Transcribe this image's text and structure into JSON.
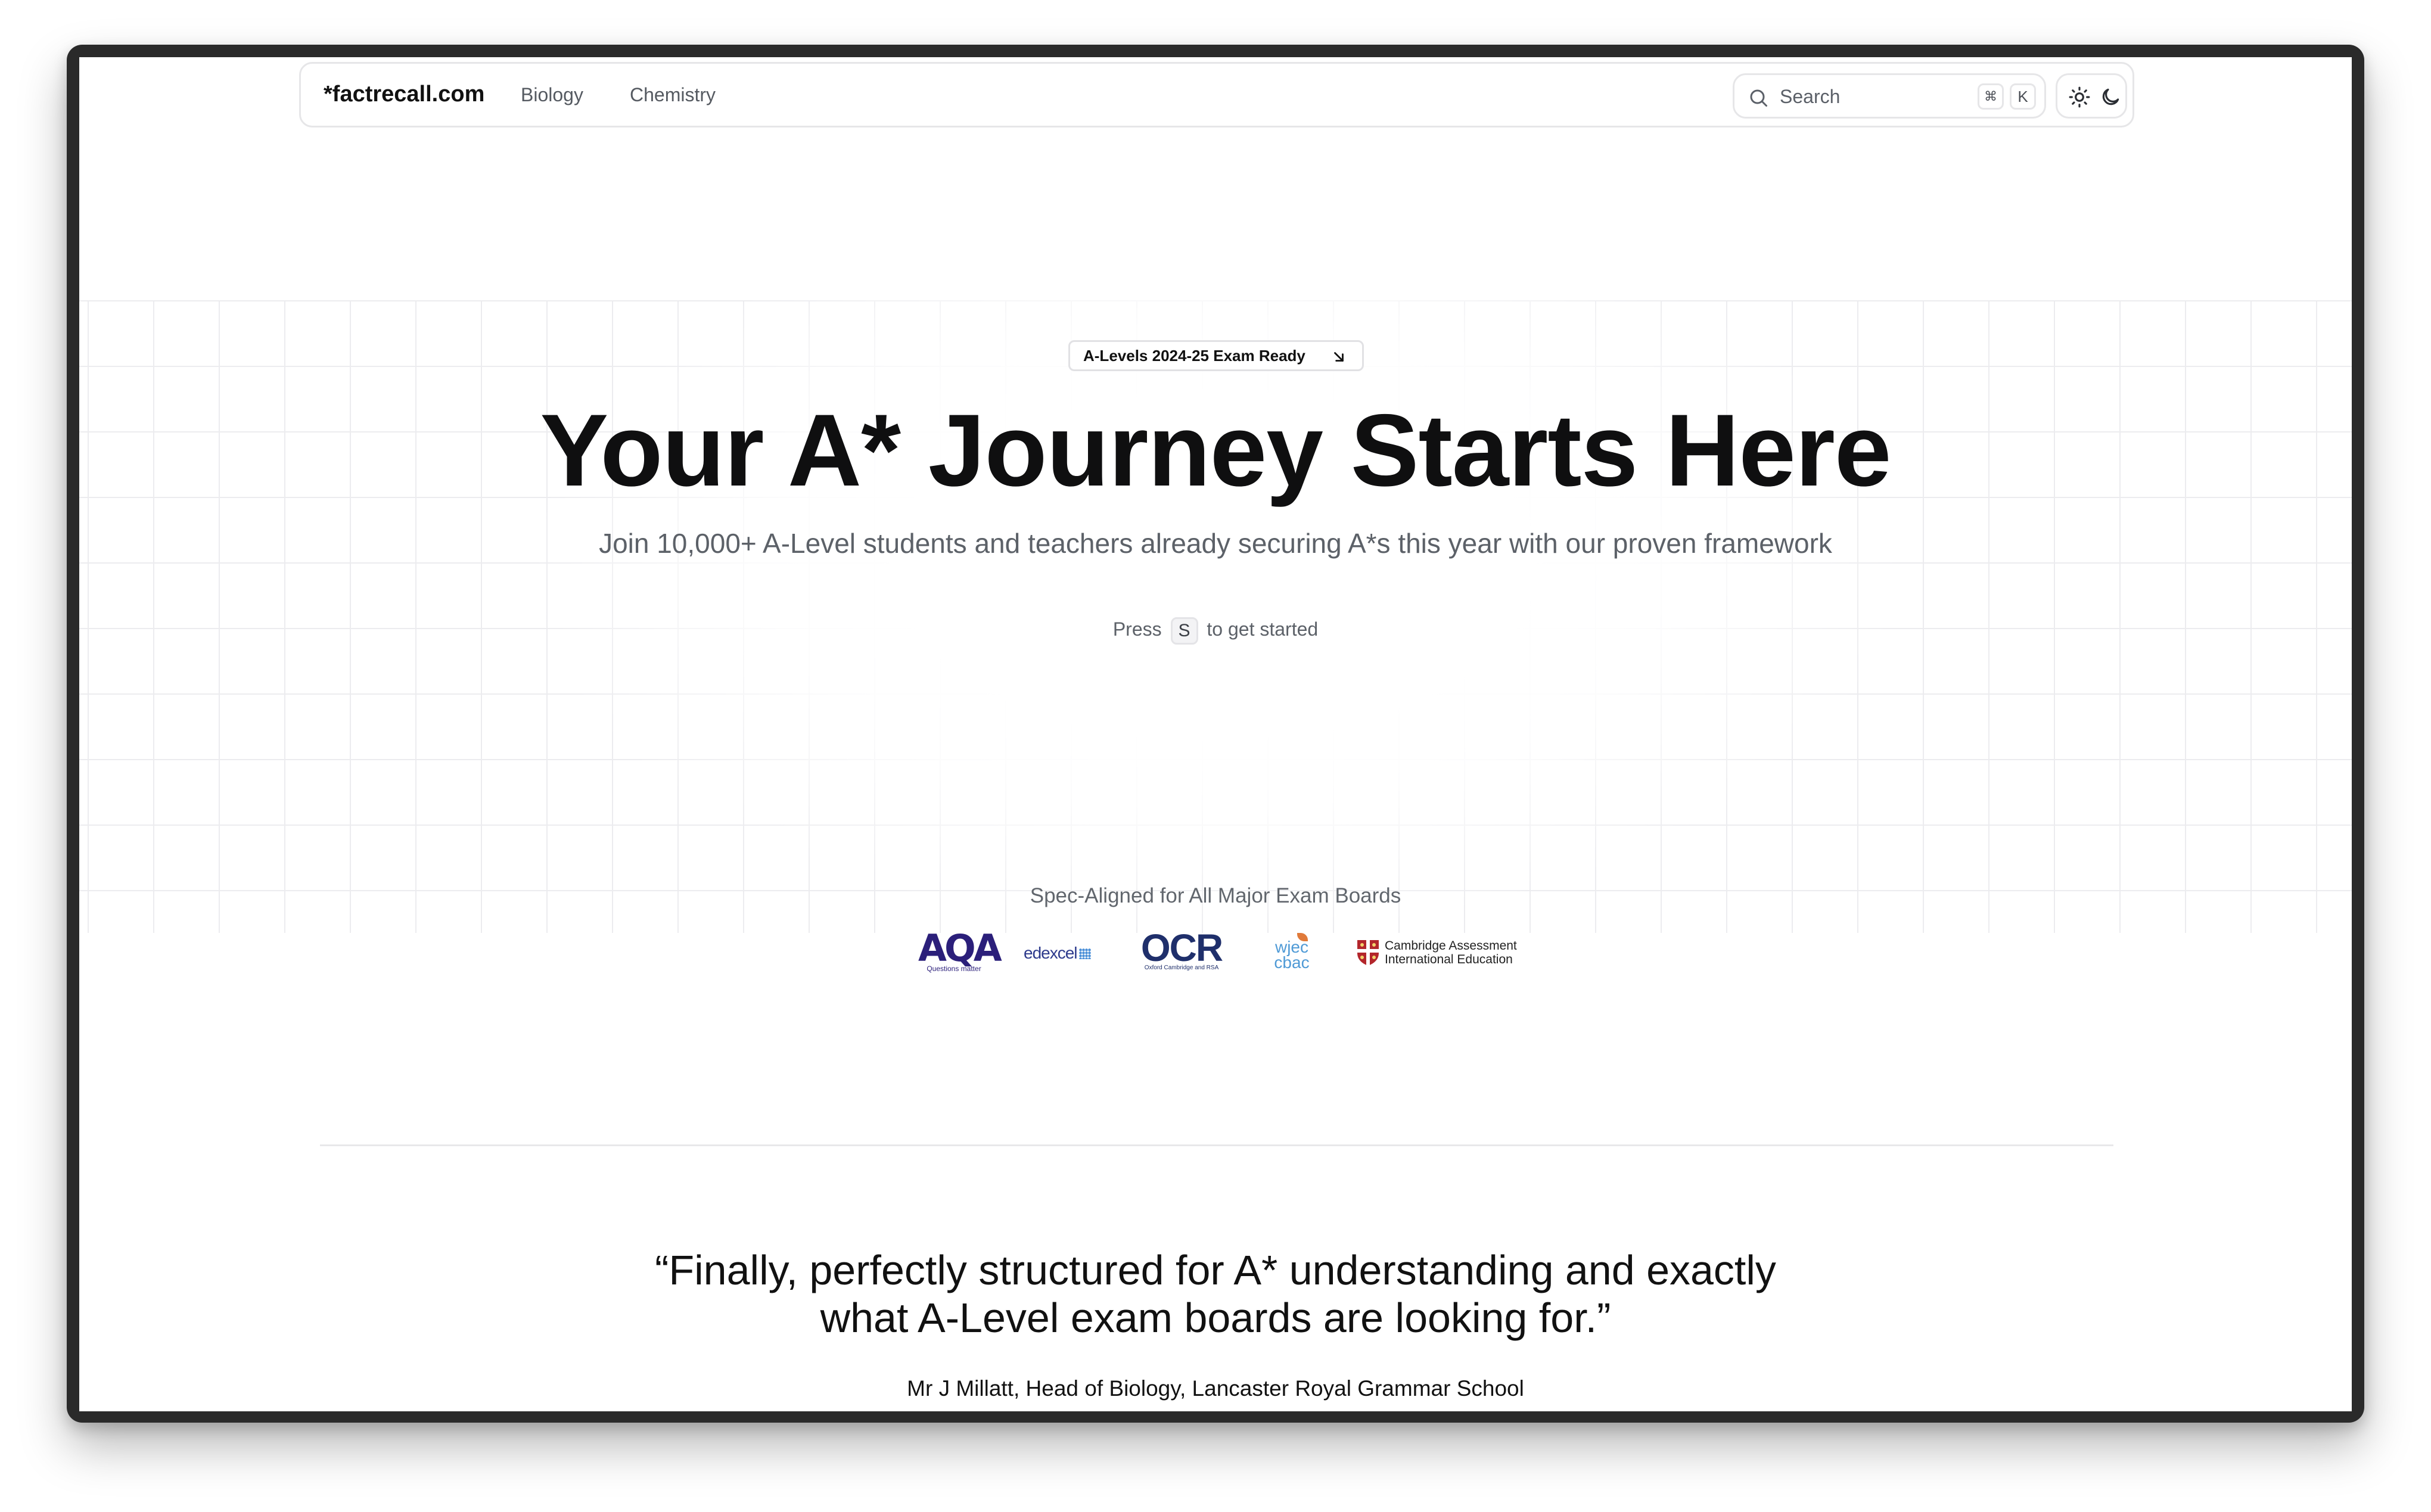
{
  "nav": {
    "brand": "*factrecall.com",
    "links": [
      "Biology",
      "Chemistry"
    ],
    "search": {
      "label": "Search",
      "shortcut_mod": "⌘",
      "shortcut_key": "K"
    },
    "theme_icons": [
      "sun-icon",
      "moon-icon"
    ]
  },
  "hero": {
    "badge": "A-Levels 2024-25 Exam Ready",
    "title": "Your A* Journey Starts Here",
    "subtitle": "Join 10,000+ A-Level students and teachers already securing A*s this year with our proven framework",
    "press_prefix": "Press",
    "press_key": "S",
    "press_suffix": "to get started"
  },
  "boards": {
    "title": "Spec-Aligned for All Major Exam Boards",
    "aqa": {
      "name": "AQA",
      "tagline": "Questions matter"
    },
    "edexcel": {
      "name": "edexcel"
    },
    "ocr": {
      "name": "OCR",
      "tagline": "Oxford Cambridge and RSA"
    },
    "wjec": {
      "line1": "wjec",
      "line2": "cbac"
    },
    "cambridge": {
      "line1": "Cambridge Assessment",
      "line2": "International Education"
    }
  },
  "testimonial": {
    "quote_line1": "“Finally, perfectly structured for A* understanding and exactly",
    "quote_line2": "what A-Level exam boards are looking for.”",
    "author": "Mr J Millatt, Head of Biology, Lancaster Royal Grammar School"
  },
  "colors": {
    "text": "#111111",
    "muted": "#5c6168",
    "border": "#e6e6e8",
    "aqa": "#2b1f7a",
    "ocr": "#1f2f6b",
    "wjec": "#4f9ad6"
  }
}
